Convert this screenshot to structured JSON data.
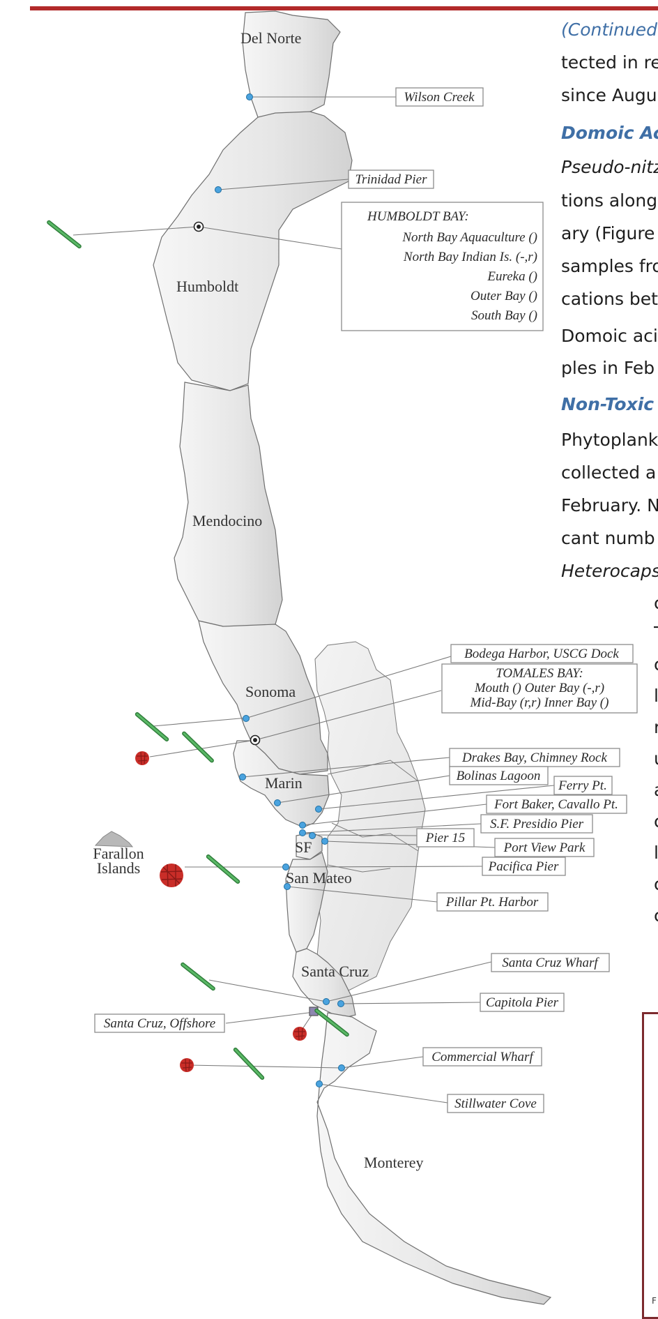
{
  "colors": {
    "topbar": "#b22a2a",
    "heading_blue": "#3f6fa6",
    "county_fill": "#e4e4e4",
    "county_fill_light": "#eeeeee",
    "county_stroke": "#6f6f6f",
    "site_dot": "#4aa3df",
    "alexandrium_red": "#d2332e",
    "pseudo_nitzschia_green": "#3c9a48",
    "frame_maroon": "#7c2a2e"
  },
  "map": {
    "counties": [
      "Del Norte",
      "Humboldt",
      "Mendocino",
      "Sonoma",
      "Marin",
      "SF",
      "San Mateo",
      "Santa Cruz",
      "Monterey"
    ],
    "islands": {
      "name_line1": "Farallon",
      "name_line2": "Islands"
    },
    "sites": {
      "wilson_creek": "Wilson Creek",
      "trinidad_pier": "Trinidad Pier",
      "humboldt_bay": {
        "title": "HUMBOLDT BAY:",
        "lines": [
          "North Bay Aquaculture ()",
          "North Bay Indian Is. (-,r)",
          "Eureka ()",
          "Outer Bay ()",
          "South Bay ()"
        ]
      },
      "bodega_harbor": "Bodega Harbor, USCG Dock",
      "tomales_bay": {
        "title": "TOMALES BAY:",
        "line1": "Mouth ()    Outer Bay (-,r)",
        "line2": "Mid-Bay (r,r)   Inner Bay ()"
      },
      "drakes_bay": "Drakes Bay, Chimney Rock",
      "bolinas_lagoon": "Bolinas Lagoon",
      "ferry_pt": "Ferry Pt.",
      "fort_baker": "Fort Baker, Cavallo Pt.",
      "sf_presidio": "S.F. Presidio Pier",
      "pier_15": "Pier 15",
      "port_view_park": "Port View Park",
      "pacifica_pier": "Pacifica Pier",
      "pillar_pt": "Pillar Pt. Harbor",
      "santa_cruz_wharf": "Santa Cruz Wharf",
      "capitola_pier": "Capitola Pier",
      "santa_cruz_offshore": "Santa Cruz, Offshore",
      "commercial_wharf": "Commercial Wharf",
      "stillwater_cove": "Stillwater Cove"
    },
    "icons": [
      "pseudo-nitzschia-cell-icon",
      "alexandrium-cluster-icon"
    ]
  },
  "text_column": {
    "lines": [
      {
        "text": "(Continued",
        "style": "cont"
      },
      {
        "text": "tected in re",
        "style": ""
      },
      {
        "text": "since Augu",
        "style": ""
      },
      {
        "text": "Domoic Ac",
        "style": "head"
      },
      {
        "text": "Pseudo-nitz",
        "style": "it"
      },
      {
        "text": "tions along",
        "style": ""
      },
      {
        "text": "ary (Figure",
        "style": ""
      },
      {
        "text": "samples fro",
        "style": ""
      },
      {
        "text": "cations bet",
        "style": ""
      },
      {
        "text": "Domoic aci",
        "style": ""
      },
      {
        "text": "ples in Feb",
        "style": ""
      },
      {
        "text": "Non-Toxic",
        "style": "head"
      },
      {
        "text": "Phytoplank",
        "style": ""
      },
      {
        "text": "collected a",
        "style": ""
      },
      {
        "text": "February. N",
        "style": ""
      },
      {
        "text": "cant numb",
        "style": ""
      },
      {
        "text": "Heterocaps",
        "style": "it"
      }
    ],
    "bullet_column_chars": [
      "c",
      "T",
      "c",
      "l",
      "r",
      "u",
      "a",
      "c",
      "l",
      "c",
      "c"
    ],
    "figure_caption": "F"
  }
}
